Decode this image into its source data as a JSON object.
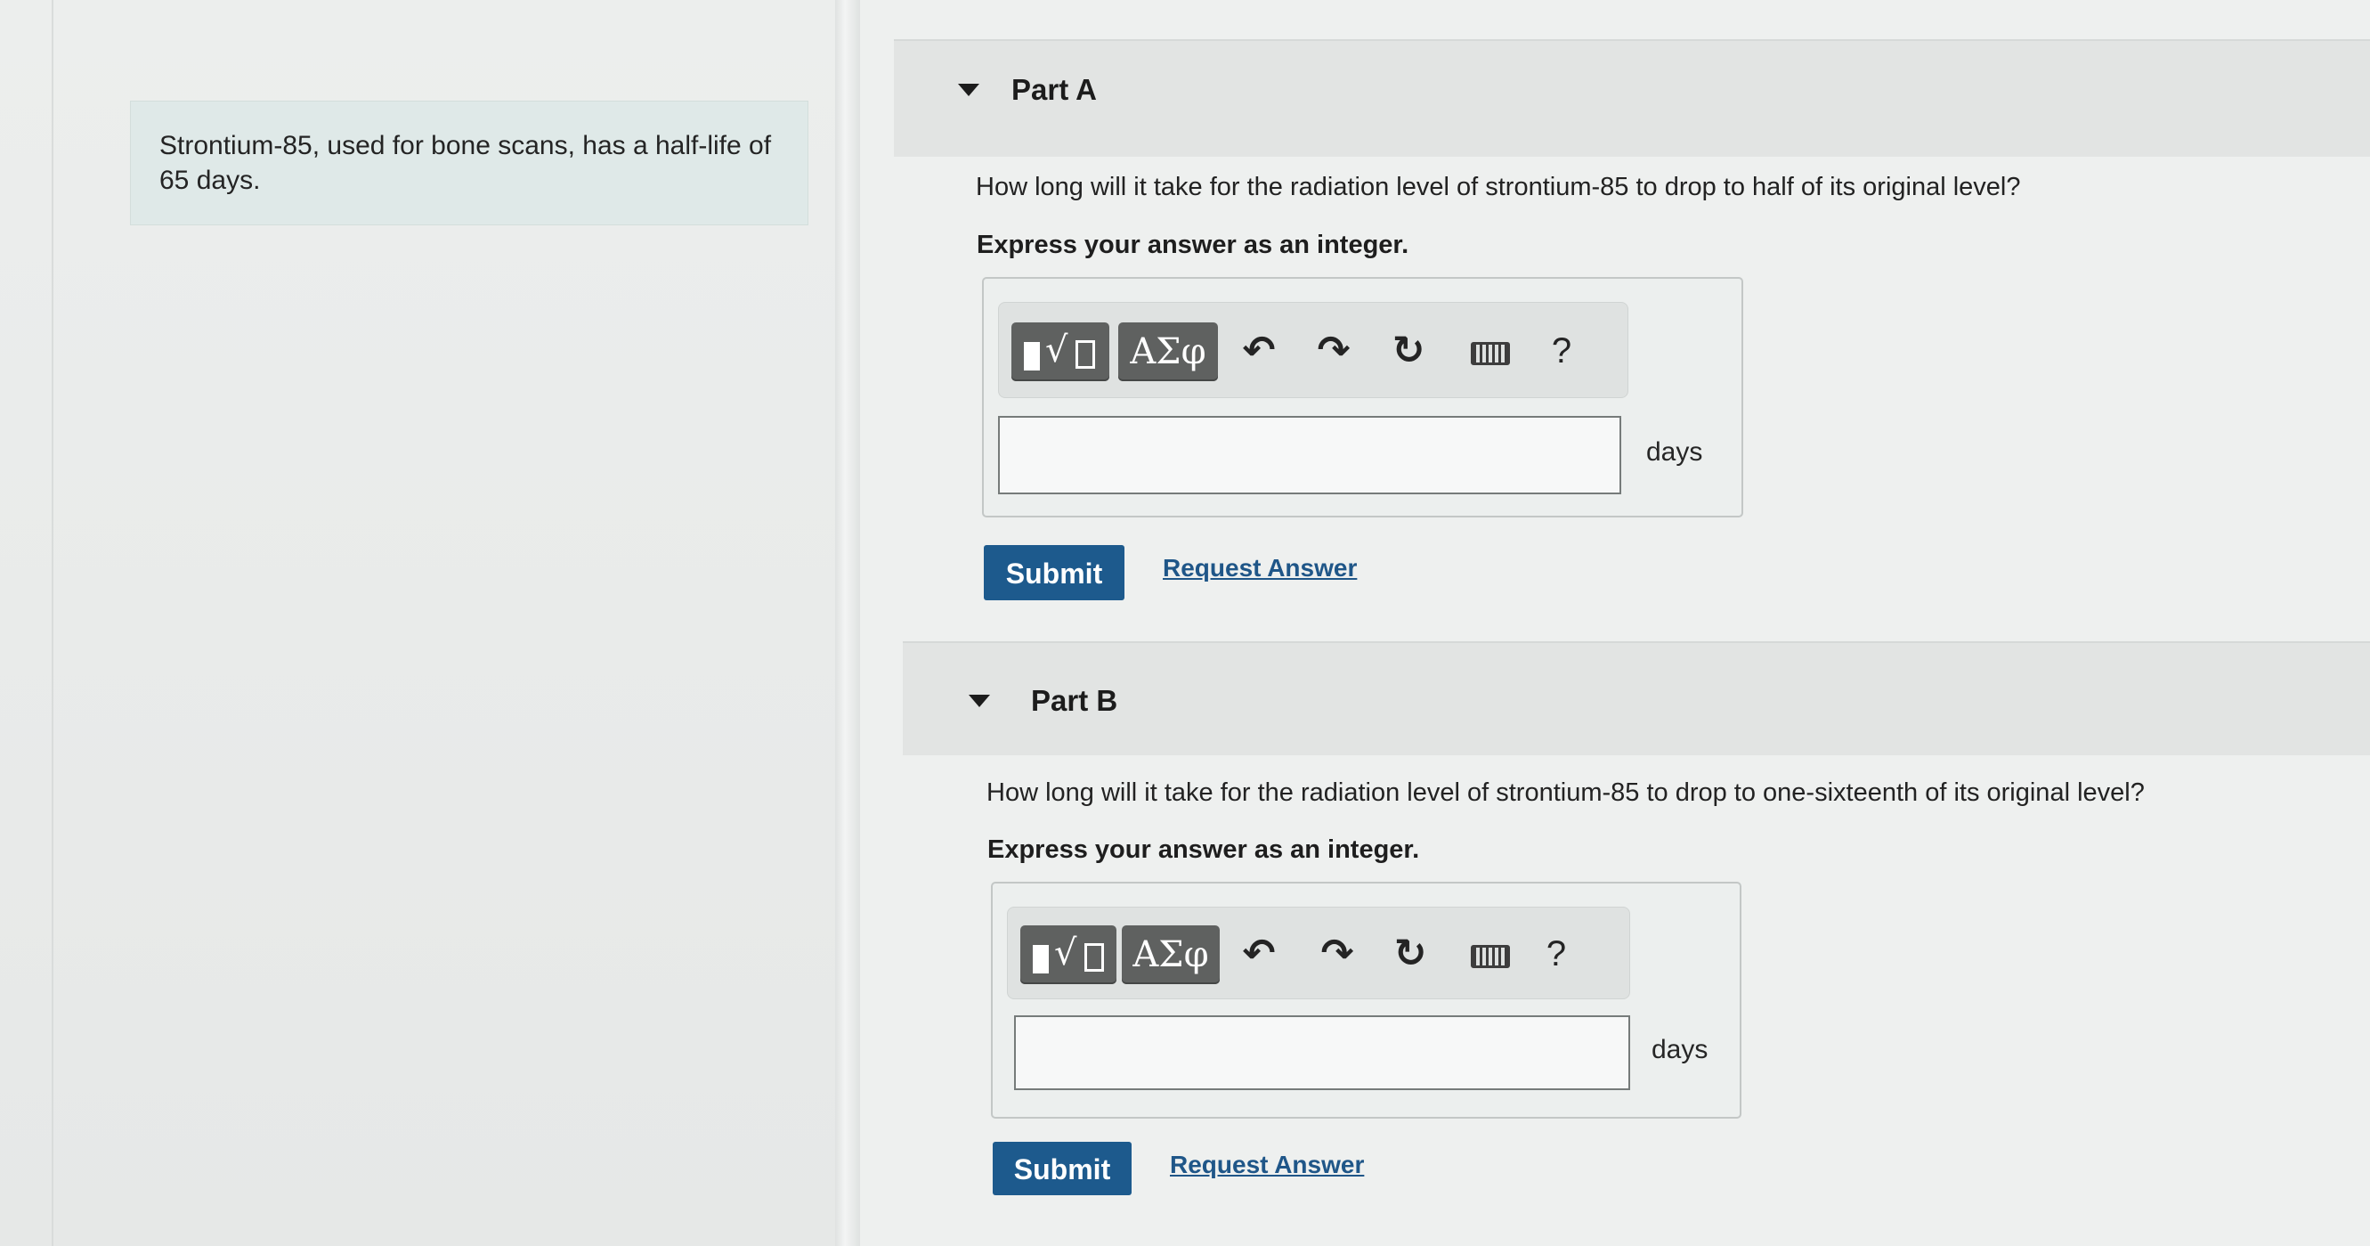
{
  "intro": {
    "text": "Strontium-85, used for bone scans, has a half-life of 65 days."
  },
  "parts": [
    {
      "title": "Part A",
      "question": "How long will it take for the radiation level of strontium-85 to drop to half of its original level?",
      "instruction": "Express your answer as an integer.",
      "answer_value": "",
      "unit": "days",
      "submit_label": "Submit",
      "request_label": "Request Answer"
    },
    {
      "title": "Part B",
      "question": "How long will it take for the radiation level of strontium-85 to drop to one-sixteenth of its original level?",
      "instruction": "Express your answer as an integer.",
      "answer_value": "",
      "unit": "days",
      "submit_label": "Submit",
      "request_label": "Request Answer"
    }
  ],
  "toolbar": {
    "greek_label": "ΑΣφ",
    "help_label": "?",
    "icons": [
      "template-icon",
      "greek-symbols-icon",
      "undo-icon",
      "redo-icon",
      "reset-icon",
      "keyboard-icon",
      "help-icon"
    ]
  },
  "colors": {
    "submit_bg": "#1d5a8d",
    "link": "#1f5688",
    "toolbar_button": "#5f6160"
  }
}
